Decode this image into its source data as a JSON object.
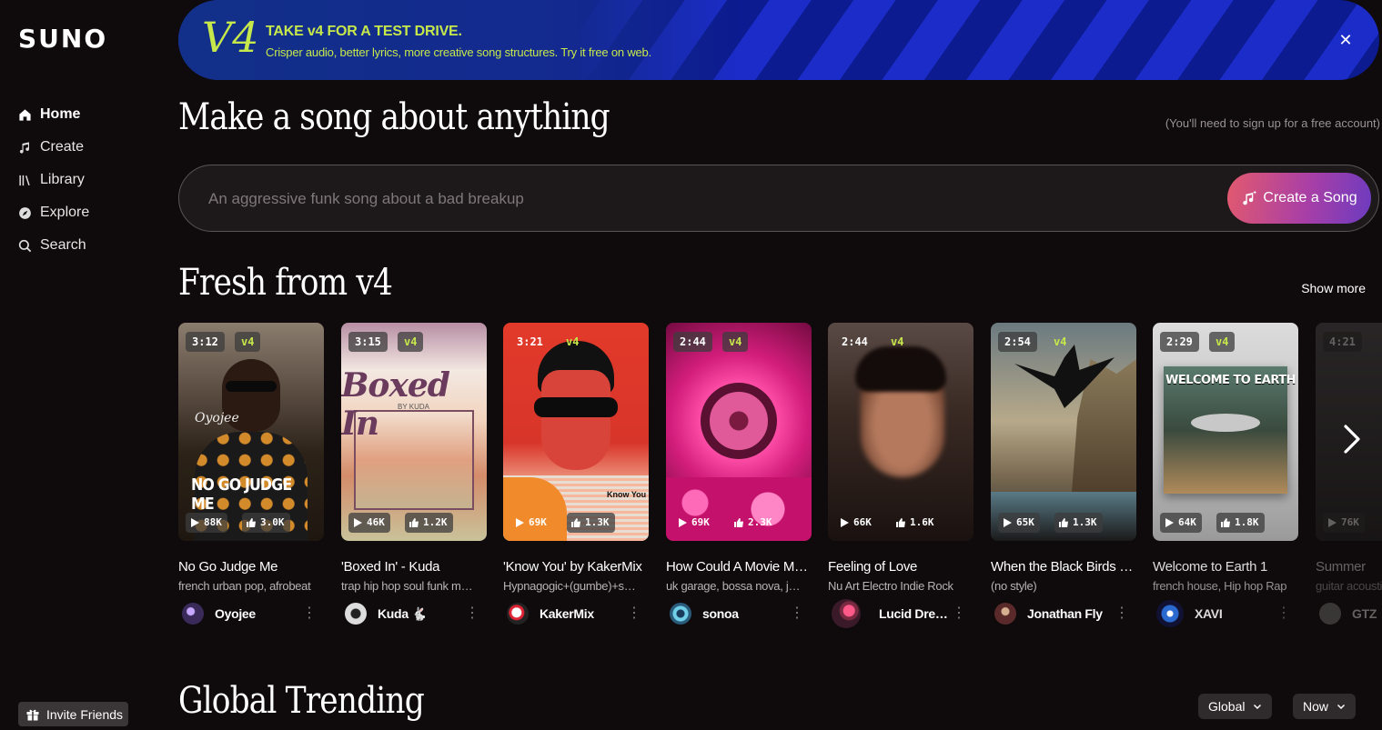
{
  "app": {
    "logo": "SUNO"
  },
  "sidebar": {
    "items": [
      {
        "label": "Home",
        "icon": "home-icon"
      },
      {
        "label": "Create",
        "icon": "music-note-icon"
      },
      {
        "label": "Library",
        "icon": "library-icon"
      },
      {
        "label": "Explore",
        "icon": "compass-icon"
      },
      {
        "label": "Search",
        "icon": "search-icon"
      }
    ],
    "invite_label": "Invite Friends"
  },
  "banner": {
    "badge": "V4",
    "title": "TAKE v4 FOR A TEST DRIVE.",
    "subtitle": "Crisper audio, better lyrics, more creative song structures. Try it free on web.",
    "accent": "#c6e84a"
  },
  "hero": {
    "title": "Make a song about anything",
    "signup_note": "(You'll need to sign up for a free account)",
    "placeholder": "An aggressive funk song about a bad breakup",
    "create_label": "Create a Song"
  },
  "fresh": {
    "title": "Fresh from v4",
    "show_more": "Show more",
    "cards": [
      {
        "duration": "3:12",
        "version": "v4",
        "plays": "88K",
        "likes": "3.0K",
        "title": "No Go Judge Me",
        "genre": "french urban pop, afrobeat",
        "artist": "Oyojee",
        "cover_text": "NO GO JUDGE ME",
        "cover_sub": "Oyojee"
      },
      {
        "duration": "3:15",
        "version": "v4",
        "plays": "46K",
        "likes": "1.2K",
        "title": "'Boxed In' - Kuda",
        "genre": "trap hip hop soul funk melodic",
        "artist": "Kuda 🐇",
        "cover_text": "Boxed In",
        "cover_sub": "BY KUDA"
      },
      {
        "duration": "3:21",
        "version": "v4",
        "plays": "69K",
        "likes": "1.3K",
        "title": "'Know You' by KakerMix",
        "genre": "Hypnagogic+(gumbe)+synthwave",
        "artist": "KakerMix",
        "cover_text": "Know You",
        "cover_sub": ""
      },
      {
        "duration": "2:44",
        "version": "v4",
        "plays": "69K",
        "likes": "2.3K",
        "title": "How Could A Movie Make Me Cry",
        "genre": "uk garage, bossa nova, jazz",
        "artist": "sonoa",
        "cover_text": "",
        "cover_sub": ""
      },
      {
        "duration": "2:44",
        "version": "v4",
        "plays": "66K",
        "likes": "1.6K",
        "title": "Feeling of Love",
        "genre": "Nu Art Electro Indie Rock",
        "artist": "Lucid Dreamer",
        "cover_text": "",
        "cover_sub": ""
      },
      {
        "duration": "2:54",
        "version": "v4",
        "plays": "65K",
        "likes": "1.3K",
        "title": "When the Black Birds Sing",
        "genre": "(no style)",
        "artist": "Jonathan Fly",
        "cover_text": "",
        "cover_sub": ""
      },
      {
        "duration": "2:29",
        "version": "v4",
        "plays": "64K",
        "likes": "1.8K",
        "title": "Welcome to Earth 1",
        "genre": "french house, Hip hop Rap",
        "artist": "XAVI",
        "cover_text": "WELCOME TO EARTH",
        "cover_sub": ""
      },
      {
        "duration": "4:21",
        "version": "",
        "plays": "76K",
        "likes": "",
        "title": "Summer",
        "genre": "guitar acoustic",
        "artist": "GTZ",
        "cover_text": "",
        "cover_sub": ""
      }
    ]
  },
  "trending": {
    "title": "Global Trending",
    "region": "Global",
    "period": "Now"
  }
}
